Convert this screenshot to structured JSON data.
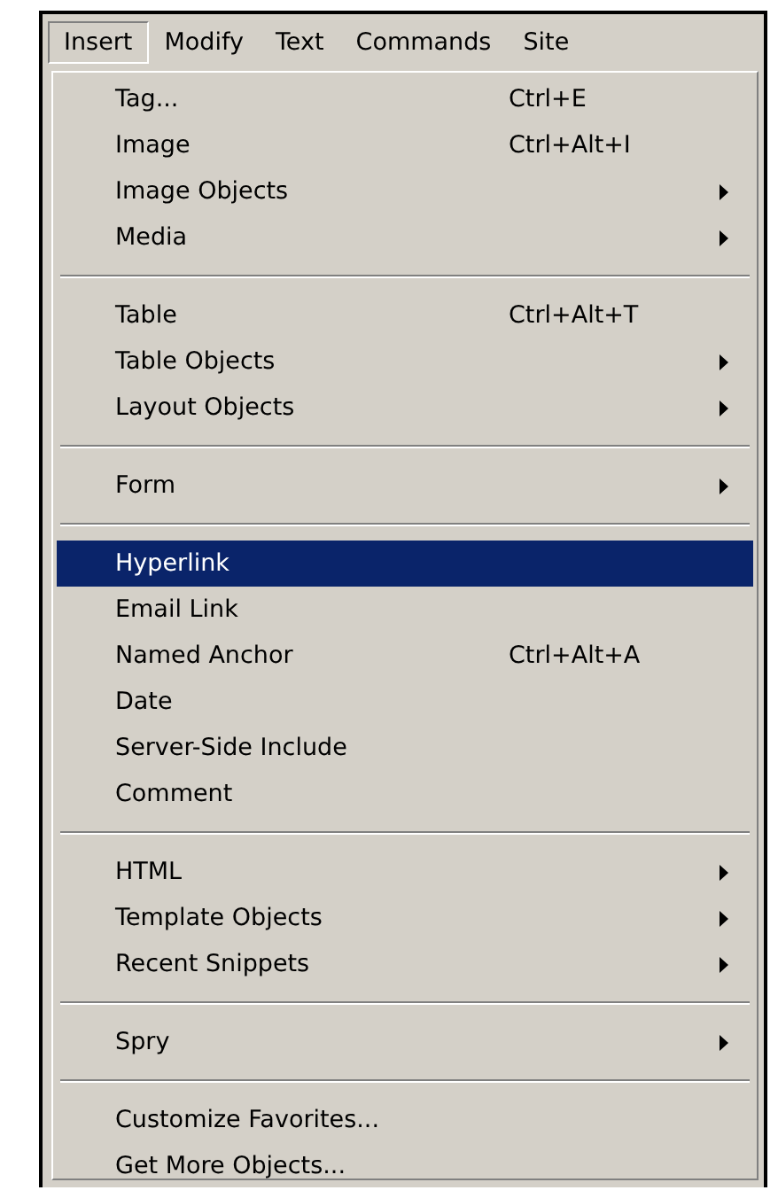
{
  "menu_bar": [
    {
      "label": "Insert",
      "selected": true
    },
    {
      "label": "Modify",
      "selected": false
    },
    {
      "label": "Text",
      "selected": false
    },
    {
      "label": "Commands",
      "selected": false
    },
    {
      "label": "Site",
      "selected": false
    }
  ],
  "menu": {
    "groups": [
      [
        {
          "label": "Tag...",
          "shortcut": "Ctrl+E",
          "submenu": false,
          "selected": false
        },
        {
          "label": "Image",
          "shortcut": "Ctrl+Alt+I",
          "submenu": false,
          "selected": false
        },
        {
          "label": "Image Objects",
          "submenu": true,
          "selected": false
        },
        {
          "label": "Media",
          "submenu": true,
          "selected": false
        }
      ],
      [
        {
          "label": "Table",
          "shortcut": "Ctrl+Alt+T",
          "submenu": false,
          "selected": false
        },
        {
          "label": "Table Objects",
          "submenu": true,
          "selected": false
        },
        {
          "label": "Layout Objects",
          "submenu": true,
          "selected": false
        }
      ],
      [
        {
          "label": "Form",
          "submenu": true,
          "selected": false
        }
      ],
      [
        {
          "label": "Hyperlink",
          "submenu": false,
          "selected": true
        },
        {
          "label": "Email Link",
          "submenu": false,
          "selected": false
        },
        {
          "label": "Named Anchor",
          "shortcut": "Ctrl+Alt+A",
          "submenu": false,
          "selected": false
        },
        {
          "label": "Date",
          "submenu": false,
          "selected": false
        },
        {
          "label": "Server-Side Include",
          "submenu": false,
          "selected": false
        },
        {
          "label": "Comment",
          "submenu": false,
          "selected": false
        }
      ],
      [
        {
          "label": "HTML",
          "submenu": true,
          "selected": false
        },
        {
          "label": "Template Objects",
          "submenu": true,
          "selected": false
        },
        {
          "label": "Recent Snippets",
          "submenu": true,
          "selected": false
        }
      ],
      [
        {
          "label": "Spry",
          "submenu": true,
          "selected": false
        }
      ],
      [
        {
          "label": "Customize Favorites...",
          "submenu": false,
          "selected": false
        },
        {
          "label": "Get More Objects...",
          "submenu": false,
          "selected": false
        }
      ]
    ]
  }
}
